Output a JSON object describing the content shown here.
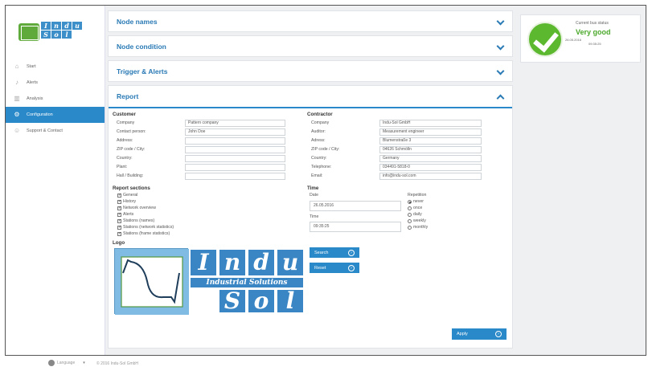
{
  "sidebar": {
    "logo_letters": [
      "I",
      "n",
      "d",
      "u",
      "S",
      "o",
      "l"
    ],
    "items": [
      {
        "label": "Start",
        "icon": "home-icon"
      },
      {
        "label": "Alerts",
        "icon": "bell-icon"
      },
      {
        "label": "Analysis",
        "icon": "chart-icon"
      },
      {
        "label": "Configuration",
        "icon": "gear-icon"
      },
      {
        "label": "Support & Contact",
        "icon": "people-icon"
      }
    ]
  },
  "accordions": [
    {
      "title": "Node names"
    },
    {
      "title": "Node condition"
    },
    {
      "title": "Trigger & Alerts"
    }
  ],
  "report": {
    "title": "Report",
    "customer": {
      "heading": "Customer",
      "fields": [
        {
          "label": "Company",
          "value": "Pattern company"
        },
        {
          "label": "Contact person:",
          "value": "John Doe"
        },
        {
          "label": "Address:",
          "value": ""
        },
        {
          "label": "ZIP code / City:",
          "value": ""
        },
        {
          "label": "Country:",
          "value": ""
        },
        {
          "label": "Plant:",
          "value": ""
        },
        {
          "label": "Hall / Building:",
          "value": ""
        }
      ]
    },
    "contractor": {
      "heading": "Contractor",
      "fields": [
        {
          "label": "Company",
          "value": "Indu-Sol GmbH"
        },
        {
          "label": "Auditor:",
          "value": "Measurement engineer"
        },
        {
          "label": "Adress:",
          "value": "Blumenstraße 3"
        },
        {
          "label": "ZIP code / City:",
          "value": "04626 Schmölln"
        },
        {
          "label": "Country:",
          "value": "Germany"
        },
        {
          "label": "Telephone:",
          "value": "034491-5818-0"
        },
        {
          "label": "Email:",
          "value": "info@indu-sol.com"
        }
      ]
    },
    "sections": {
      "heading": "Report sections",
      "items": [
        "General",
        "History",
        "Network overview",
        "Alerts",
        "Stations (names)",
        "Stations (network statistics)",
        "Stations (frame statistics)"
      ]
    },
    "time": {
      "heading": "Time",
      "date_label": "Date",
      "date_value": "26.05.2016",
      "time_label": "Time",
      "time_value": "09:35:25",
      "repetition_label": "Repetition",
      "repetition_options": [
        "never",
        "once",
        "daily",
        "weekly",
        "monthly"
      ],
      "repetition_selected": "never"
    },
    "logo": {
      "heading": "Logo",
      "search_label": "Search",
      "reset_label": "Reset",
      "brand_top": [
        "I",
        "n",
        "d",
        "u"
      ],
      "brand_middle": "Industrial Solutions",
      "brand_bottom": [
        "S",
        "o",
        "l"
      ]
    },
    "apply_label": "Apply"
  },
  "status": {
    "label": "Current bus status",
    "value": "Very good",
    "date": "26.05.2016",
    "time": "09:35:25"
  },
  "footer": {
    "language": "Language",
    "copyright": "© 2016 Indu-Sol GmbH"
  },
  "colors": {
    "accent": "#2a89c8",
    "status_green": "#5cb82e"
  }
}
